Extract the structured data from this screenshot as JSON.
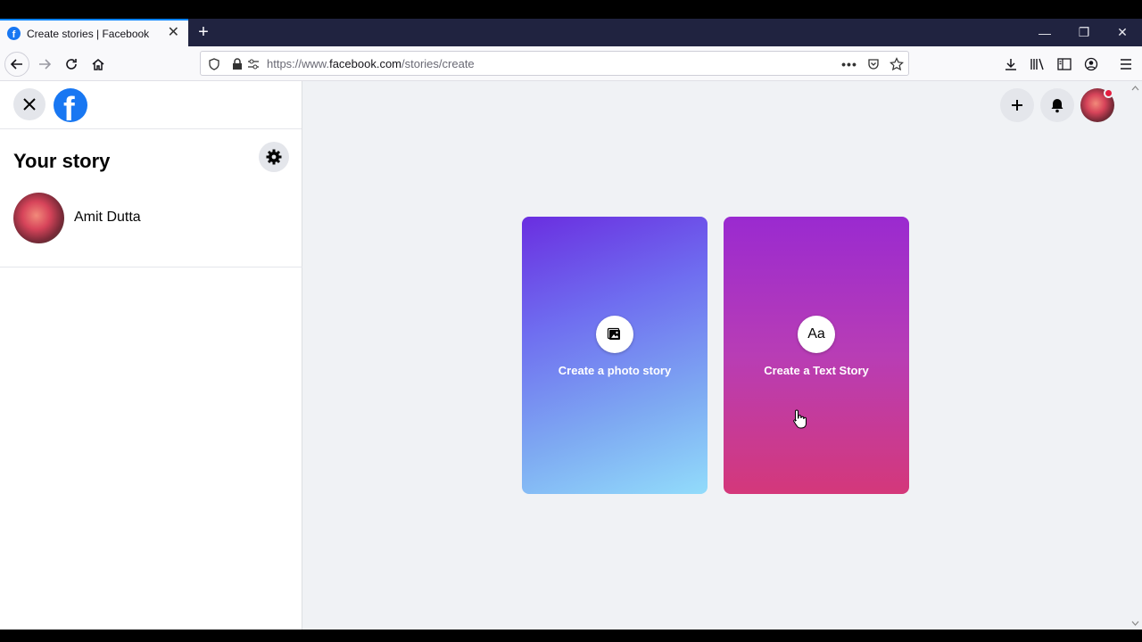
{
  "browser": {
    "tab_title": "Create stories | Facebook",
    "tab_close": "✕",
    "new_tab": "+",
    "url_prefix": "https://www.",
    "url_domain": "facebook.com",
    "url_path": "/stories/create",
    "window_controls": [
      "—",
      "❐",
      "✕"
    ]
  },
  "sidebar": {
    "close_icon": "✕",
    "logo_letter": "f",
    "heading": "Your story",
    "user_name": "Amit Dutta"
  },
  "cards": {
    "photo_label": "Create a photo story",
    "text_label": "Create a Text Story",
    "text_icon": "Aa"
  },
  "colors": {
    "facebook_blue": "#1877f2",
    "notification_dot": "#e41e3f"
  }
}
